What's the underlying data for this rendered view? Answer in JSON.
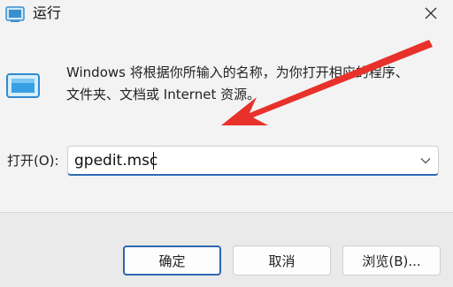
{
  "window": {
    "title": "运行",
    "icons": {
      "app": "run-app-icon",
      "close": "close-icon",
      "large": "run-large-icon"
    }
  },
  "dialog": {
    "description_line1": "Windows 将根据你所输入的名称，为你打开相应的程序、",
    "description_line2": "文件夹、文档或 Internet 资源。",
    "open_label": "打开(O):",
    "open_value": "gpedit.msc",
    "dropdown_icon": "chevron-down-icon"
  },
  "buttons": {
    "ok": "确定",
    "cancel": "取消",
    "browse": "浏览(B)..."
  },
  "colors": {
    "accent": "#2b67b0",
    "annotation_arrow": "#e8312a"
  }
}
